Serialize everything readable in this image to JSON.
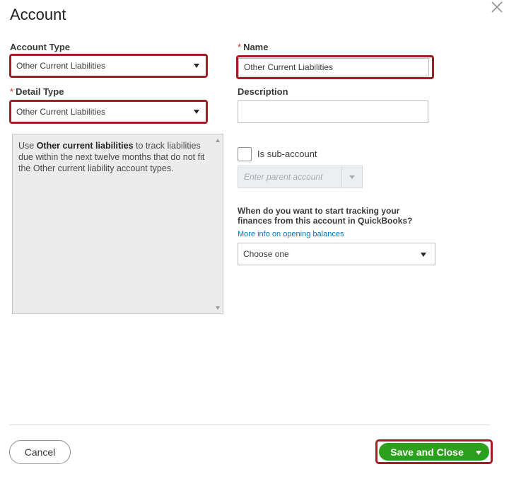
{
  "dialog": {
    "title": "Account"
  },
  "account_type": {
    "label": "Account Type",
    "value": "Other Current Liabilities"
  },
  "name": {
    "required_mark": "*",
    "label": "Name",
    "value": "Other Current Liabilities"
  },
  "detail_type": {
    "required_mark": "*",
    "label": "Detail Type",
    "value": "Other Current Liabilities"
  },
  "description": {
    "label": "Description",
    "value": ""
  },
  "detail_help": {
    "prefix": "Use ",
    "bold": "Other current liabilities",
    "suffix": " to track liabilities due within the next twelve months that do not fit the Other current liability account types."
  },
  "sub_account": {
    "label": "Is sub-account",
    "checked": false,
    "parent_placeholder": "Enter parent account"
  },
  "opening_balance": {
    "question": "When do you want to start tracking your finances from this account in QuickBooks?",
    "link": "More info on opening balances",
    "selected": "Choose one"
  },
  "footer": {
    "cancel_label": "Cancel",
    "save_label": "Save and Close"
  },
  "colors": {
    "highlight": "#a51c24",
    "primary_green": "#2ca01c",
    "link_blue": "#0077c5",
    "required_red": "#d52b1e"
  }
}
